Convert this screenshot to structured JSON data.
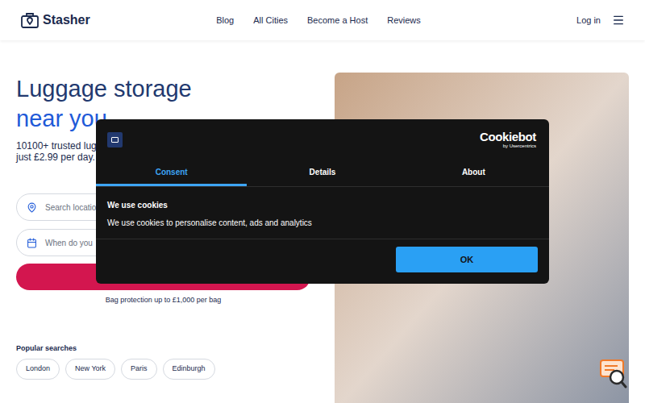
{
  "header": {
    "logo": "Stasher",
    "nav": [
      "Blog",
      "All Cities",
      "Become a Host",
      "Reviews"
    ],
    "login": "Log in"
  },
  "hero": {
    "title_line1": "Luggage storage",
    "title_line2": "near you",
    "subtitle_lines": [
      "10100+ trusted lug",
      "just £2.99 per day."
    ],
    "search": {
      "location_placeholder": "Search locatio",
      "date_placeholder": "When do you"
    },
    "protection": "Bag protection up to £1,000 per bag",
    "popular_title": "Popular searches",
    "popular": [
      "London",
      "New York",
      "Paris",
      "Edinburgh"
    ]
  },
  "cookie_dialog": {
    "brand": "Cookiebot",
    "brand_sub": "by Usercentrics",
    "tabs": [
      {
        "label": "Consent",
        "selected": true
      },
      {
        "label": "Details",
        "selected": false
      },
      {
        "label": "About",
        "selected": false
      }
    ],
    "heading": "We use cookies",
    "body": "We use cookies to personalise content, ads and analytics",
    "buttons": [
      "OK"
    ]
  }
}
